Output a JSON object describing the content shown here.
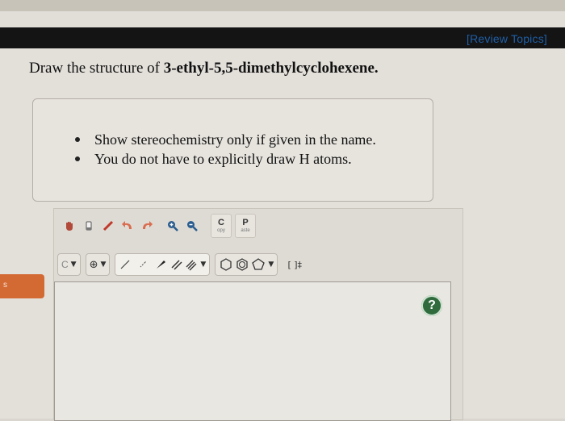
{
  "header": {
    "review_link": "[Review Topics]"
  },
  "question": {
    "prefix": "Draw the structure of ",
    "compound": "3-ethyl-5,5-dimethylcyclohexene."
  },
  "hints": [
    "Show stereochemistry only if given in the name.",
    "You do not have to explicitly draw H atoms."
  ],
  "toolbar": {
    "copy_big": "C",
    "copy_small": "opy",
    "paste_big": "P",
    "paste_small": "aste",
    "element_label": "C",
    "charge_label": "⊕",
    "bracket_label": "[ ]‡"
  },
  "canvas": {
    "help_label": "?"
  },
  "colors": {
    "link": "#1f5fa8",
    "help_button": "#2f6b3c",
    "side_tab": "#d36a34"
  }
}
